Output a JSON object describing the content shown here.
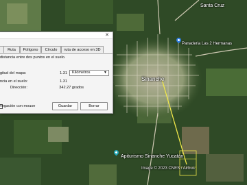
{
  "map": {
    "labels": {
      "town_ne": "Santa Cruz",
      "place_bakery": "Panaderia Las 2 Hermanas",
      "town_center": "Sinanche",
      "place_tourism": "Apiturismo Sinanche Yucatán",
      "attribution": "Image © 2023 CNES / Airbus"
    },
    "colors": {
      "pin_blue": "#2f7de1",
      "pin_teal": "#22a7b5",
      "ruler_line": "#f1e84a"
    }
  },
  "dialog": {
    "tabs": [
      {
        "label": "Ruta"
      },
      {
        "label": "Polígono"
      },
      {
        "label": "Círculo"
      },
      {
        "label": "ruta de acceso en 3D"
      }
    ],
    "description": "distancia entre dos puntos en el suelo.",
    "map_length_label": "gitud del mapa:",
    "map_length_value": "1.31",
    "unit_selected": "Kilómetros",
    "ground_length_label": "ncia en el suelo:",
    "ground_length_value": "1.31",
    "heading_label": "Dirección:",
    "heading_value": "342.27 grados",
    "mouse_nav_label": "vegación con mouse",
    "save_label": "Guardar",
    "clear_label": "Borrar"
  }
}
